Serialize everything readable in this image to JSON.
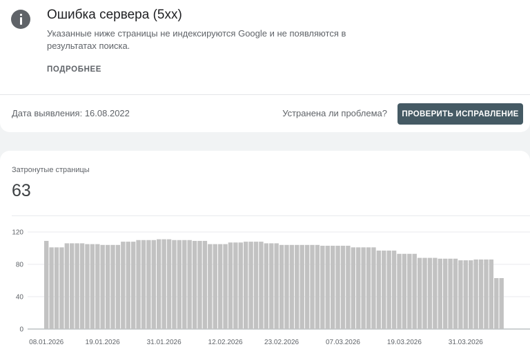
{
  "issue": {
    "title": "Ошибка сервера (5xx)",
    "description": "Указанные ниже страницы не индексируются Google и не появляются в результатах поиска.",
    "more_label": "ПОДРОБНЕЕ"
  },
  "validation": {
    "detected_label": "Дата выявления: 16.08.2022",
    "question": "Устранена ли проблема?",
    "button_label": "ПРОВЕРИТЬ ИСПРАВЛЕНИЕ"
  },
  "metric": {
    "label": "Затронутые страницы",
    "value": "63"
  },
  "colors": {
    "bar": "#c2c2c2",
    "button": "#455a64"
  },
  "chart_data": {
    "type": "bar",
    "ylim": [
      0,
      120
    ],
    "yticks": [
      0,
      40,
      80,
      120
    ],
    "grid": true,
    "x_tick_labels": [
      "08.01.2026",
      "19.01.2026",
      "31.01.2026",
      "12.02.2026",
      "23.02.2026",
      "07.03.2026",
      "19.03.2026",
      "31.03.2026"
    ],
    "x_tick_indices": [
      0,
      11,
      23,
      35,
      46,
      58,
      70,
      82
    ],
    "values": [
      109,
      101,
      101,
      101,
      106,
      106,
      106,
      106,
      105,
      105,
      105,
      104,
      104,
      104,
      104,
      108,
      108,
      108,
      110,
      110,
      110,
      110,
      111,
      111,
      111,
      110,
      110,
      110,
      110,
      109,
      109,
      109,
      105,
      105,
      105,
      105,
      107,
      107,
      107,
      108,
      108,
      108,
      108,
      106,
      106,
      106,
      104,
      104,
      104,
      104,
      104,
      104,
      104,
      104,
      103,
      103,
      103,
      103,
      103,
      103,
      101,
      101,
      101,
      101,
      101,
      97,
      97,
      97,
      97,
      93,
      93,
      93,
      93,
      88,
      88,
      88,
      88,
      87,
      87,
      87,
      87,
      85,
      85,
      85,
      86,
      86,
      86,
      86,
      63,
      63
    ]
  }
}
